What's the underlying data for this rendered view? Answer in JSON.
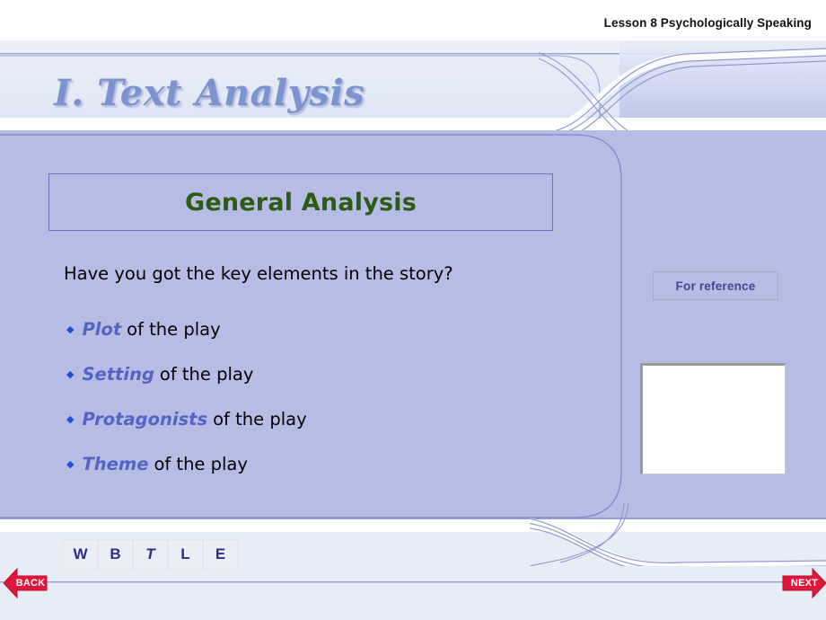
{
  "header": {
    "lesson_label": "Lesson 8  Psychologically Speaking"
  },
  "title": {
    "text": "I. Text Analysis"
  },
  "headline": {
    "text": "General Analysis"
  },
  "content": {
    "question": "Have you got the key elements in the story?",
    "bullets": [
      {
        "marker": "◆",
        "keyword": "Plot",
        "rest": "of the play"
      },
      {
        "marker": "◆",
        "keyword": "Setting",
        "rest": "of the play"
      },
      {
        "marker": "◆",
        "keyword": "Protagonists",
        "rest": "of the play"
      },
      {
        "marker": "◆",
        "keyword": "Theme",
        "rest": "of the play"
      }
    ]
  },
  "sidebar": {
    "for_reference_label": "For reference"
  },
  "footer": {
    "nav_letters": [
      {
        "label": "W",
        "italic": false
      },
      {
        "label": "B",
        "italic": false
      },
      {
        "label": "T",
        "italic": true
      },
      {
        "label": "L",
        "italic": false
      },
      {
        "label": "E",
        "italic": false
      }
    ],
    "back_label": "BACK",
    "next_label": "NEXT"
  },
  "colors": {
    "content_panel": "#b5bde5",
    "band_light": "#e7edf7",
    "title_text": "#7b93ce",
    "headline_text": "#2c5b14",
    "keyword_text": "#5663c4",
    "bullet_marker": "#1f4fdd",
    "arrow_red": "#e0173c",
    "frame_line": "#6b75c8"
  }
}
